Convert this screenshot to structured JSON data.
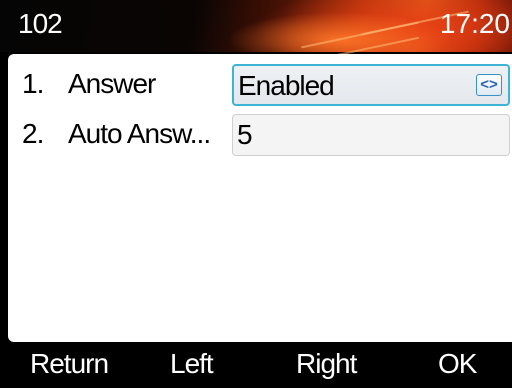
{
  "header": {
    "extension": "102",
    "time": "17:20"
  },
  "rows": [
    {
      "number": "1.",
      "label": "Answer",
      "value": "Enabled",
      "control": "select",
      "control_icon": "left-right-arrows-icon"
    },
    {
      "number": "2.",
      "label": "Auto Answ...",
      "value": "5",
      "control": "input"
    }
  ],
  "softkeys": [
    "Return",
    "Left",
    "Right",
    "OK"
  ],
  "colors": {
    "header_accent": "#e05a1a",
    "focus_border": "#3db4d6",
    "panel_bg": "#ffffff",
    "softkey_bg": "#000000"
  }
}
